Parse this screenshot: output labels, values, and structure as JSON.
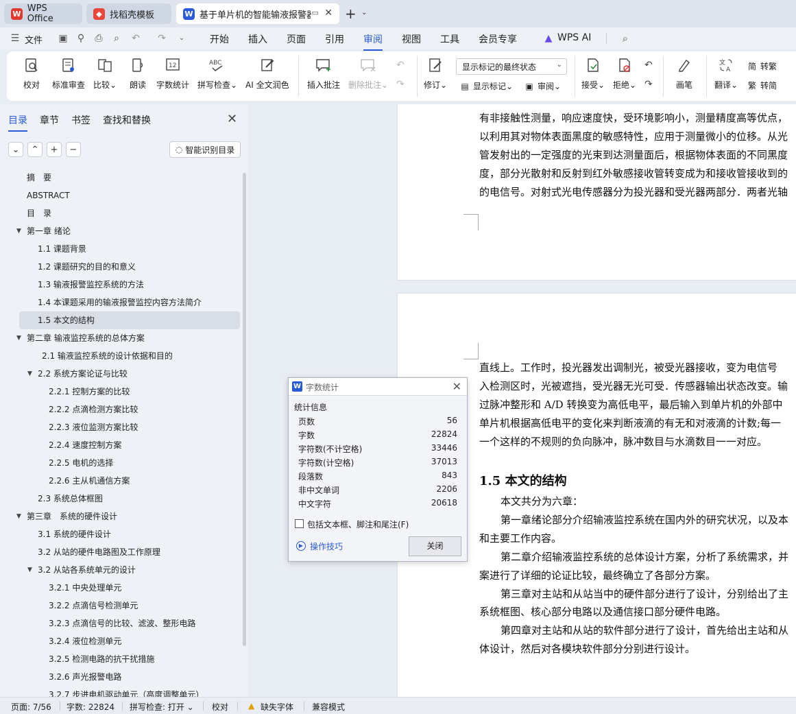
{
  "tabs": [
    {
      "label": "WPS Office",
      "icon": "wps-logo-icon"
    },
    {
      "label": "找稻壳模板",
      "icon": "docer-icon"
    },
    {
      "label": "基于单片机的智能输液报警器",
      "icon": "wps-writer-icon",
      "active": true
    }
  ],
  "menubar": {
    "file": "文件",
    "items": [
      "开始",
      "插入",
      "页面",
      "引用",
      "审阅",
      "视图",
      "工具",
      "会员专享"
    ],
    "active": "审阅",
    "wps_ai": "WPS AI"
  },
  "ribbon": {
    "proofread": "校对",
    "standard_review": "标准审查",
    "compare": "比较",
    "read_aloud": "朗读",
    "word_count": "字数统计",
    "spell_check": "拼写检查",
    "ai_polish": "AI 全文润色",
    "insert_comment": "插入批注",
    "delete_comment": "删除批注",
    "revise": "修订",
    "markup_mode": "显示标记的最终状态",
    "show_markup": "显示标记",
    "review_pane": "审阅",
    "accept": "接受",
    "reject": "拒绝",
    "ink": "画笔",
    "translate": "翻译",
    "to_simplified": "转简",
    "to_traditional": "转繁"
  },
  "nav": {
    "tabs": [
      "目录",
      "章节",
      "书签",
      "查找和替换"
    ],
    "smart_toc": "智能识别目录",
    "toc": [
      {
        "label": "摘　要",
        "level": 0,
        "arrow": false
      },
      {
        "label": "ABSTRACT",
        "level": 0,
        "arrow": false
      },
      {
        "label": "目　录",
        "level": 0,
        "arrow": false
      },
      {
        "label": "第一章 绪论",
        "level": 0,
        "arrow": true
      },
      {
        "label": "1.1 课题背景",
        "level": 1,
        "arrow": false
      },
      {
        "label": "1.2 课题研究的目的和意义",
        "level": 1,
        "arrow": false
      },
      {
        "label": "1.3 输液报警监控系统的方法",
        "level": 1,
        "arrow": false
      },
      {
        "label": "1.4 本课题采用的输液报警监控内容方法简介",
        "level": 1,
        "arrow": false
      },
      {
        "label": "1.5 本文的结构",
        "level": 1,
        "arrow": false,
        "selected": true
      },
      {
        "label": "第二章 输液监控系统的总体方案",
        "level": 0,
        "arrow": true
      },
      {
        "label": "2.1 输液监控系统的设计依据和目的",
        "level": 1.4,
        "arrow": false
      },
      {
        "label": "2.2 系统方案论证与比较",
        "level": 1,
        "arrow": true
      },
      {
        "label": "2.2.1 控制方案的比较",
        "level": 2,
        "arrow": false
      },
      {
        "label": "2.2.2 点滴检测方案比较",
        "level": 2,
        "arrow": false
      },
      {
        "label": "2.2.3 液位监测方案比较",
        "level": 2,
        "arrow": false
      },
      {
        "label": "2.2.4 速度控制方案",
        "level": 2,
        "arrow": false
      },
      {
        "label": "2.2.5 电机的选择",
        "level": 2,
        "arrow": false
      },
      {
        "label": "2.2.6 主从机通信方案",
        "level": 2,
        "arrow": false
      },
      {
        "label": "2.3 系统总体框图",
        "level": 1,
        "arrow": false
      },
      {
        "label": "第三章　系统的硬件设计",
        "level": 0,
        "arrow": true
      },
      {
        "label": "3.1 系统的硬件设计",
        "level": 1,
        "arrow": false
      },
      {
        "label": "3.2 从站的硬件电路图及工作原理",
        "level": 1,
        "arrow": false
      },
      {
        "label": "3.2 从站各系统单元的设计",
        "level": 1,
        "arrow": true
      },
      {
        "label": "3.2.1 中央处理单元",
        "level": 2,
        "arrow": false
      },
      {
        "label": "3.2.2 点滴信号检测单元",
        "level": 2,
        "arrow": false
      },
      {
        "label": "3.2.3 点滴信号的比较、滤波、整形电路",
        "level": 2,
        "arrow": false
      },
      {
        "label": "3.2.4 液位检测单元",
        "level": 2,
        "arrow": false
      },
      {
        "label": "3.2.5 检测电路的抗干扰措施",
        "level": 2,
        "arrow": false
      },
      {
        "label": "3.2.6 声光报警电路",
        "level": 2,
        "arrow": false
      },
      {
        "label": "3.2.7 步进电机驱动单元（高度调整单元）",
        "level": 2,
        "arrow": false
      }
    ]
  },
  "document": {
    "page1_lines": [
      "有非接触性测量，响应速度快，受环境影响小，测量精度高等优点，",
      "以利用其对物体表面黑度的敏感特性，应用于测量微小的位移。从光",
      "管发射出的一定强度的光束到达测量面后，根据物体表面的不同黑度",
      "度，部分光散射和反射到红外敏感接收管转变成为和接收管接收到的",
      "的电信号。对射式光电传感器分为投光器和受光器两部分．两者光轴"
    ],
    "page2_lines": [
      "直线上。工作时，投光器发出调制光，被受光器接收，变为电信号",
      "入检测区时，光被遮挡，受光器无光可受．传感器输出状态改变。输",
      "过脉冲整形和 A/D 转换变为高低电平，最后输入到单片机的外部中",
      "单片机根据高低电平的变化来判断液滴的有无和对液滴的计数;每一",
      "一个这样的不规则的负向脉冲，脉冲数目与水滴数目一一对应。"
    ],
    "heading": "1.5 本文的结构",
    "body_lines": [
      "本文共分为六章：",
      "第一章绪论部分介绍输液监控系统在国内外的研究状况，以及本",
      "和主要工作内容。",
      "第二章介绍输液监控系统的总体设计方案，分析了系统需求，并",
      "案进行了详细的论证比较，最终确立了各部分方案。",
      "第三章对主站和从站当中的硬件部分进行了设计，分别给出了主",
      "系统框图、核心部分电路以及通信接口部分硬件电路。",
      "第四章对主站和从站的软件部分进行了设计，首先给出主站和从",
      "体设计，然后对各模块软件部分分别进行设计。"
    ]
  },
  "wordcount_dialog": {
    "title": "字数统计",
    "section": "统计信息",
    "rows": [
      {
        "label": "页数",
        "value": "56"
      },
      {
        "label": "字数",
        "value": "22824"
      },
      {
        "label": "字符数(不计空格)",
        "value": "33446"
      },
      {
        "label": "字符数(计空格)",
        "value": "37013"
      },
      {
        "label": "段落数",
        "value": "843"
      },
      {
        "label": "非中文单词",
        "value": "2206"
      },
      {
        "label": "中文字符",
        "value": "20618"
      }
    ],
    "checkbox_label": "包括文本框、脚注和尾注(F)",
    "tips": "操作技巧",
    "close": "关闭"
  },
  "statusbar": {
    "page": "页面: 7/56",
    "words": "字数: 22824",
    "spell": "拼写检查: 打开",
    "proof": "校对",
    "missing_font": "缺失字体",
    "compat": "兼容模式"
  },
  "colors": {
    "accent": "#2a5bd7",
    "wps_red": "#e03a2f"
  }
}
